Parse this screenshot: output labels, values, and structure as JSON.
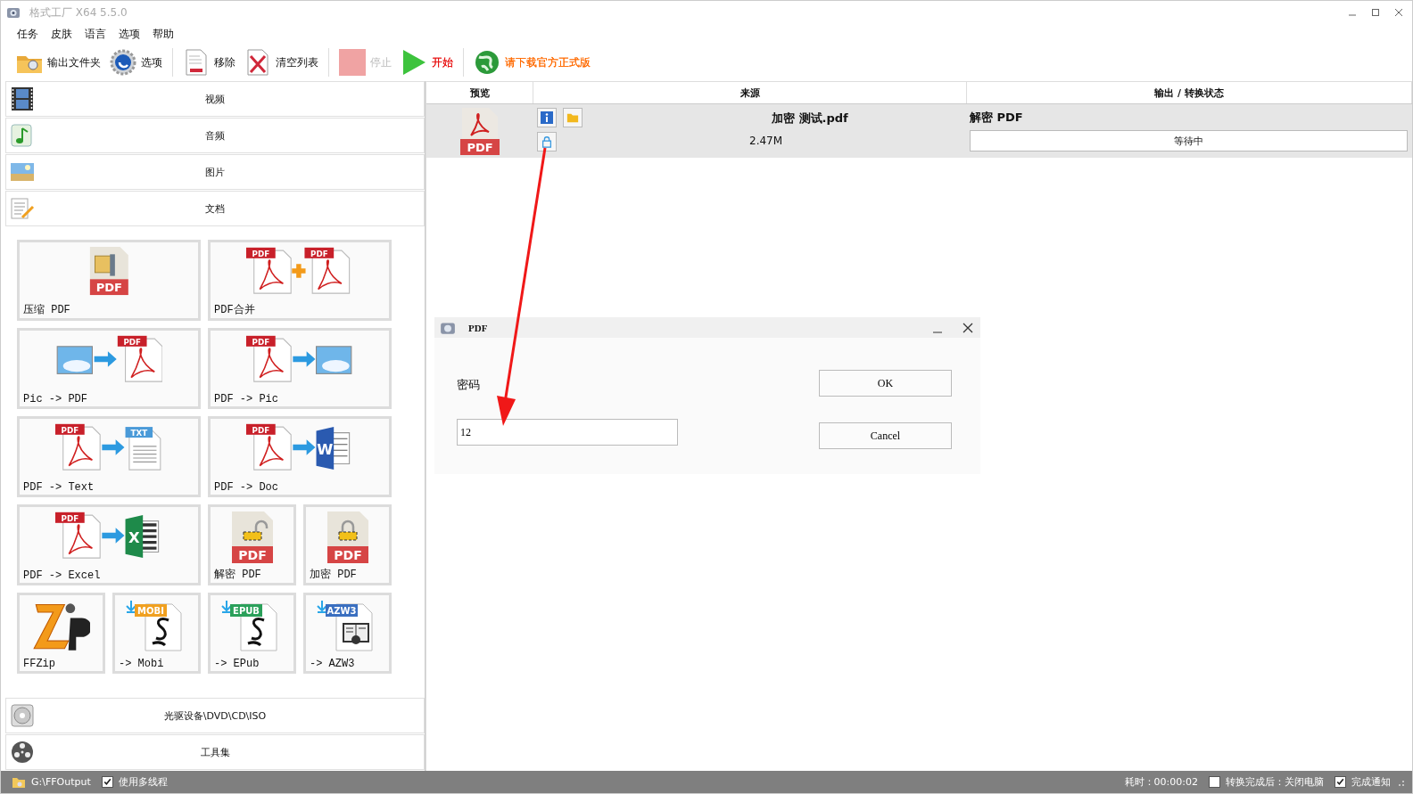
{
  "window": {
    "title": "格式工厂 X64 5.5.0"
  },
  "menu": [
    "任务",
    "皮肤",
    "语言",
    "选项",
    "帮助"
  ],
  "toolbar": [
    [
      {
        "label": "输出文件夹",
        "kind": "folder",
        "disabled": false
      },
      {
        "label": "选项",
        "kind": "gear",
        "disabled": false
      }
    ],
    [
      {
        "label": "移除",
        "kind": "remove",
        "disabled": false
      },
      {
        "label": "清空列表",
        "kind": "clear",
        "disabled": false
      }
    ],
    [
      {
        "label": "停止",
        "kind": "stop",
        "disabled": true
      },
      {
        "label": "开始",
        "kind": "play",
        "disabled": false,
        "color": "#e81010"
      }
    ],
    [
      {
        "label": "请下载官方正式版",
        "kind": "globe",
        "disabled": false,
        "color": "#ff6a00"
      }
    ]
  ],
  "categories": [
    {
      "label": "视频",
      "kind": "film"
    },
    {
      "label": "音频",
      "kind": "note"
    },
    {
      "label": "图片",
      "kind": "landscape"
    },
    {
      "label": "文档",
      "kind": "document"
    }
  ],
  "tiles": [
    {
      "label": "压缩 PDF",
      "kind": "compress",
      "marks": [
        "PDF"
      ]
    },
    {
      "label": "PDF合并",
      "kind": "merge",
      "marks": [
        "PDF",
        "PDF"
      ]
    },
    {
      "label": "Pic -> PDF",
      "kind": "pic2pdf",
      "marks": [
        "PDF"
      ]
    },
    {
      "label": "PDF -> Pic",
      "kind": "pdf2pic",
      "marks": [
        "PDF"
      ]
    },
    {
      "label": "PDF -> Text",
      "kind": "pdf2txt",
      "marks": [
        "PDF",
        "TXT"
      ]
    },
    {
      "label": "PDF -> Doc",
      "kind": "pdf2doc",
      "marks": [
        "PDF",
        "W"
      ]
    },
    {
      "label": "PDF -> Excel",
      "kind": "pdf2xls",
      "marks": [
        "PDF",
        "X"
      ]
    },
    {
      "label": "解密 PDF",
      "kind": "unlock",
      "marks": [
        "PDF"
      ]
    },
    {
      "label": "加密 PDF",
      "kind": "lock",
      "marks": [
        "PDF"
      ]
    },
    {
      "label": "FFZip",
      "kind": "zip"
    },
    {
      "label": "-> Mobi",
      "kind": "ebook",
      "marks": [
        "MOBI"
      ],
      "color": "#f0a020"
    },
    {
      "label": "-> EPub",
      "kind": "ebook",
      "marks": [
        "EPUB"
      ],
      "color": "#2aa05a"
    },
    {
      "label": "-> AZW3",
      "kind": "reader",
      "marks": [
        "AZW3"
      ],
      "color": "#3a6fc0"
    }
  ],
  "bottom_categories": [
    {
      "label": "光驱设备\\DVD\\CD\\ISO",
      "kind": "disc"
    },
    {
      "label": "工具集",
      "kind": "reel"
    }
  ],
  "table": {
    "columns": [
      "预览",
      "来源",
      "输出 / 转换状态"
    ],
    "rows": [
      {
        "preview": "PDF",
        "source": "加密 测试.pdf",
        "size": "2.47M",
        "output": "解密 PDF",
        "status": "等待中"
      }
    ]
  },
  "dialog": {
    "title": "PDF",
    "label": "密码",
    "value": "12",
    "buttons": [
      "OK",
      "Cancel"
    ]
  },
  "status_bar": {
    "path": "G:\\FFOutput",
    "multithread": {
      "label": "使用多线程",
      "checked": true
    },
    "elapsed": "耗时：00:00:02",
    "shutdown": {
      "label": "转换完成后：关闭电脑",
      "checked": false
    },
    "notify": {
      "label": "完成通知",
      "checked": true
    }
  }
}
